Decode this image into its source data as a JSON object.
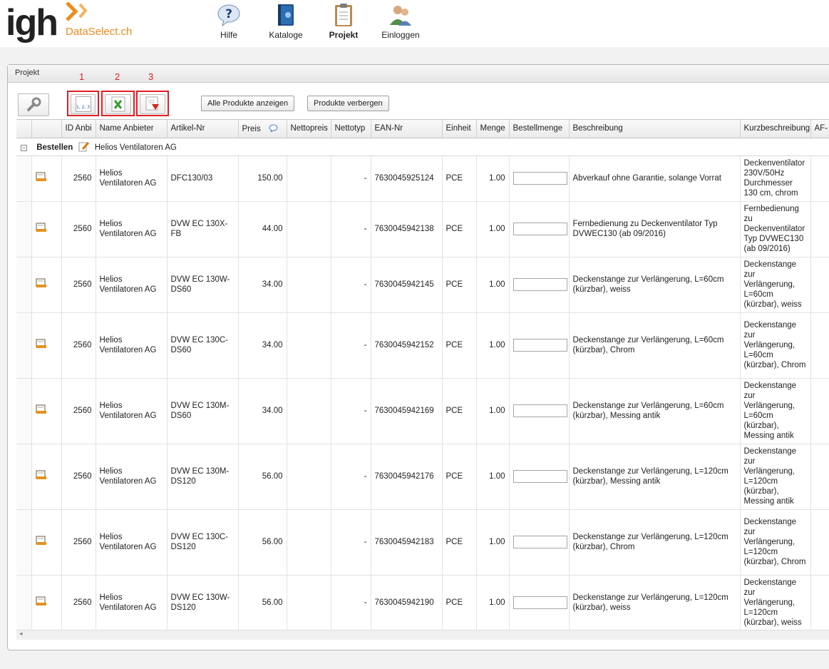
{
  "brand": {
    "logo_text": "igh",
    "sub_text": "DataSelect.ch",
    "accent": "#f08a1c"
  },
  "nav": [
    {
      "label": "Hilfe",
      "icon": "help-icon"
    },
    {
      "label": "Kataloge",
      "icon": "catalog-book-icon"
    },
    {
      "label": "Projekt",
      "icon": "clipboard-icon",
      "active": true
    },
    {
      "label": "Einloggen",
      "icon": "users-icon"
    }
  ],
  "panel": {
    "title": "Projekt"
  },
  "toolbar": {
    "markers": [
      "1",
      "2",
      "3"
    ],
    "numbering_label": "1, 2, 3",
    "show_all_label": "Alle Produkte anzeigen",
    "hide_label": "Produkte verbergen",
    "marker_color": "#e21d24"
  },
  "table": {
    "columns": [
      "ID Anbi",
      "Name Anbieter",
      "Artikel-Nr",
      "Preis",
      "Nettopreis",
      "Nettotyp",
      "EAN-Nr",
      "Einheit",
      "Menge",
      "Bestellmenge",
      "Beschreibung",
      "Kurzbeschreibung",
      "AF-"
    ],
    "group": {
      "label": "Bestellen",
      "collapse": "−",
      "vendor": "Helios Ventilatoren AG"
    },
    "rows": [
      {
        "id": "2560",
        "name": "Helios Ventilatoren AG",
        "article": "DFC130/03",
        "price": "150.00",
        "nettotyp": "-",
        "ean": "7630045925124",
        "unit": "PCE",
        "qty": "1.00",
        "desc": "Abverkauf ohne Garantie, solange Vorrat",
        "short": "Deckenventilator 230V/50Hz Durchmesser 130 cm, chrom"
      },
      {
        "id": "2560",
        "name": "Helios Ventilatoren AG",
        "article": "DVW EC 130X-FB",
        "price": "44.00",
        "nettotyp": "-",
        "ean": "7630045942138",
        "unit": "PCE",
        "qty": "1.00",
        "desc": "Fernbedienung zu Deckenventilator Typ DVWEC130 (ab 09/2016)",
        "short": "Fernbedienung zu Deckenventilator Typ DVWEC130 (ab 09/2016)"
      },
      {
        "id": "2560",
        "name": "Helios Ventilatoren AG",
        "article": "DVW EC 130W-DS60",
        "price": "34.00",
        "nettotyp": "-",
        "ean": "7630045942145",
        "unit": "PCE",
        "qty": "1.00",
        "desc": "Deckenstange zur Verlängerung, L=60cm (kürzbar), weiss",
        "short": "Deckenstange zur Verlängerung, L=60cm (kürzbar), weiss"
      },
      {
        "id": "2560",
        "name": "Helios Ventilatoren AG",
        "article": "DVW EC 130C-DS60",
        "price": "34.00",
        "nettotyp": "-",
        "ean": "7630045942152",
        "unit": "PCE",
        "qty": "1.00",
        "desc": "Deckenstange zur Verlängerung, L=60cm (kürzbar), Chrom",
        "short": "Deckenstange zur Verlängerung, L=60cm (kürzbar), Chrom"
      },
      {
        "id": "2560",
        "name": "Helios Ventilatoren AG",
        "article": "DVW EC 130M-DS60",
        "price": "34.00",
        "nettotyp": "-",
        "ean": "7630045942169",
        "unit": "PCE",
        "qty": "1.00",
        "desc": "Deckenstange zur Verlängerung, L=60cm (kürzbar), Messing antik",
        "short": "Deckenstange zur Verlängerung, L=60cm (kürzbar), Messing antik"
      },
      {
        "id": "2560",
        "name": "Helios Ventilatoren AG",
        "article": "DVW EC 130M-DS120",
        "price": "56.00",
        "nettotyp": "-",
        "ean": "7630045942176",
        "unit": "PCE",
        "qty": "1.00",
        "desc": "Deckenstange zur Verlängerung, L=120cm (kürzbar), Messing antik",
        "short": "Deckenstange zur Verlängerung, L=120cm (kürzbar), Messing antik"
      },
      {
        "id": "2560",
        "name": "Helios Ventilatoren AG",
        "article": "DVW EC 130C-DS120",
        "price": "56.00",
        "nettotyp": "-",
        "ean": "7630045942183",
        "unit": "PCE",
        "qty": "1.00",
        "desc": "Deckenstange zur Verlängerung, L=120cm (kürzbar), Chrom",
        "short": "Deckenstange zur Verlängerung, L=120cm (kürzbar), Chrom"
      },
      {
        "id": "2560",
        "name": "Helios Ventilatoren AG",
        "article": "DVW EC 130W-DS120",
        "price": "56.00",
        "nettotyp": "-",
        "ean": "7630045942190",
        "unit": "PCE",
        "qty": "1.00",
        "desc": "Deckenstange zur Verlängerung, L=120cm (kürzbar), weiss",
        "short": "Deckenstange zur Verlängerung, L=120cm (kürzbar), weiss"
      }
    ]
  },
  "scroll_arrow": "◂"
}
